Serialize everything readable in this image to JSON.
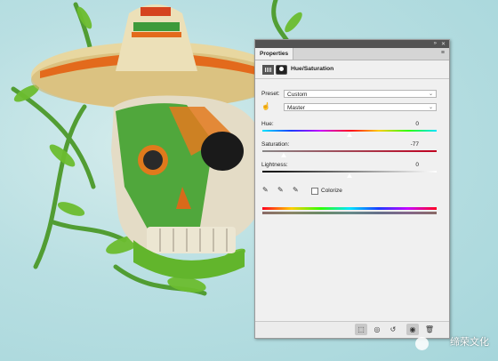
{
  "panel": {
    "tab": "Properties",
    "title": "Hue/Saturation",
    "preset_label": "Preset:",
    "preset_value": "Custom",
    "channel_value": "Master",
    "hue_label": "Hue:",
    "hue_value": "0",
    "saturation_label": "Saturation:",
    "saturation_value": "-77",
    "lightness_label": "Lightness:",
    "lightness_value": "0",
    "colorize_label": "Colorize",
    "colorize_checked": false,
    "slider_levels": {
      "hue": 0.5,
      "saturation": 0.12,
      "lightness": 0.5
    }
  },
  "icons": {
    "collapse": "collapse-arrows-icon",
    "close": "close-icon",
    "menu": "panel-menu-icon",
    "hand": "on-image-adjust-icon",
    "eyedropper": "eyedropper-icon",
    "eyedropper_add": "eyedropper-plus-icon",
    "eyedropper_sub": "eyedropper-minus-icon",
    "clip": "clip-to-layer-icon",
    "view_prev": "view-previous-state-icon",
    "reset": "reset-icon",
    "visibility": "visibility-eye-icon",
    "delete": "trash-icon"
  },
  "watermark": {
    "text": "缔荣文化"
  },
  "colors": {
    "panel_bg": "#f0f0f0",
    "topbar": "#535353",
    "background": "#b9dfe2"
  }
}
